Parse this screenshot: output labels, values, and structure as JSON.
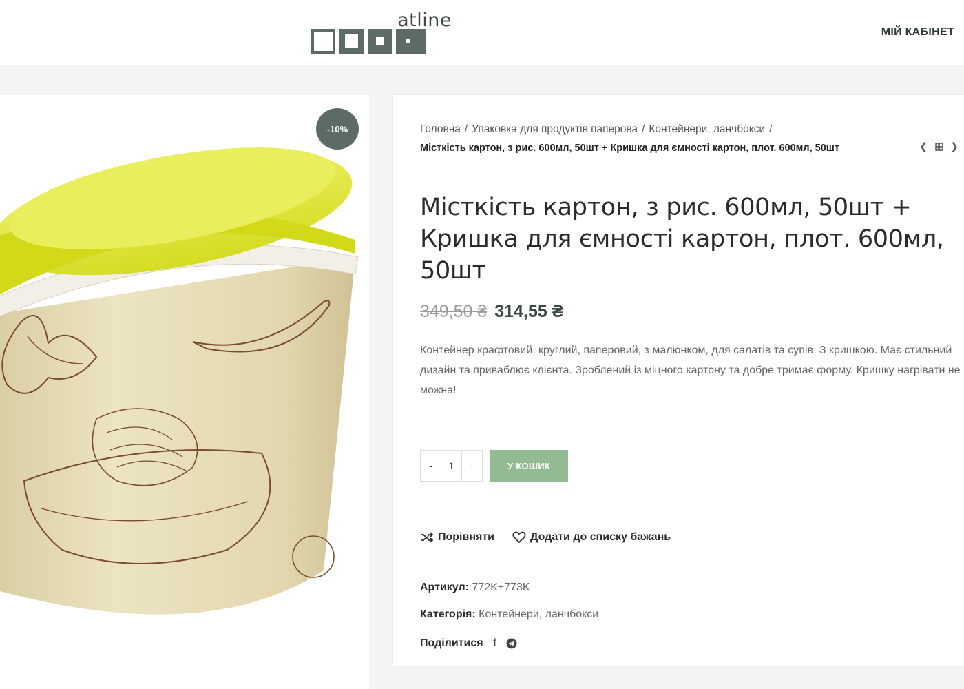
{
  "header": {
    "logo_text": "atline",
    "account_label": "МІЙ КАБІНЕТ"
  },
  "product": {
    "sale_badge": "-10%",
    "breadcrumb": [
      {
        "label": "Головна"
      },
      {
        "label": "Упаковка для продуктів паперова"
      },
      {
        "label": "Контейнери, ланчбокси"
      }
    ],
    "breadcrumb_current": "Місткість картон, з рис. 600мл, 50шт + Кришка для ємності картон, плот. 600мл, 50шт",
    "title": "Місткість картон, з рис. 600мл, 50шт + Кришка для ємності картон, плот. 600мл, 50шт",
    "price_old": "349,50 ₴",
    "price_new": "314,55 ₴",
    "description": "Контейнер крафтовий, круглий, паперовий, з малюнком, для салатів та супів. З кришкою. Має стильний дизайн та приваблює клієнта. Зроблений із міцного картону та добре тримає форму. Кришку нагрівати не можна!",
    "qty_minus": "-",
    "qty_value": "1",
    "qty_plus": "+",
    "add_to_cart": "У КОШИК",
    "compare_label": "Порівняти",
    "wishlist_label": "Додати до списку бажань",
    "sku_label": "Артикул:",
    "sku_value": "772K+773K",
    "category_label": "Категорія:",
    "category_value": "Контейнери, ланчбокси",
    "share_label": "Поділитися"
  },
  "colors": {
    "accent": "#5c6b68",
    "cart_button": "#93bb93",
    "lid": "#e3ea3c",
    "cup": "#e9dfb8",
    "drawing": "#7a4a2e"
  }
}
